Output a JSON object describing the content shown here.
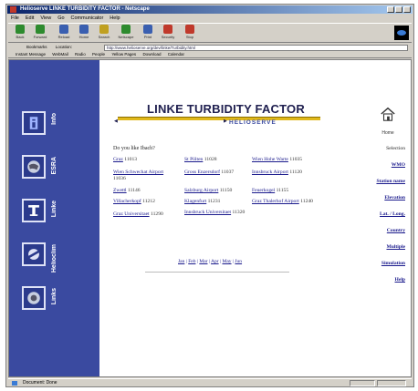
{
  "window": {
    "title": "Helioserve LINKE TURBIDITY FACTOR - Netscape"
  },
  "menu": [
    "File",
    "Edit",
    "View",
    "Go",
    "Communicator",
    "Help"
  ],
  "toolbar": {
    "buttons": [
      {
        "label": "Back",
        "icon": "back-icon",
        "color": "#2e8b2e"
      },
      {
        "label": "Forward",
        "icon": "forward-icon",
        "color": "#2e8b2e"
      },
      {
        "label": "Reload",
        "icon": "reload-icon",
        "color": "#3a5fb0"
      },
      {
        "label": "Home",
        "icon": "home-icon",
        "color": "#3a5fb0"
      },
      {
        "label": "Search",
        "icon": "search-icon",
        "color": "#c0a020"
      },
      {
        "label": "Netscape",
        "icon": "netscape-icon",
        "color": "#2e8b2e"
      },
      {
        "label": "Print",
        "icon": "print-icon",
        "color": "#3a5fb0"
      },
      {
        "label": "Security",
        "icon": "security-icon",
        "color": "#c0392b"
      },
      {
        "label": "Stop",
        "icon": "stop-icon",
        "color": "#c0392b"
      }
    ]
  },
  "address": {
    "bookmarks_label": "Bookmarks",
    "location_label": "Location:",
    "url": "http://www.helioserve.org/dev/linke/Turbidity.html"
  },
  "personal_bar": [
    "Instant Message",
    "WebMail",
    "Radio",
    "People",
    "Yellow Pages",
    "Download",
    "Calendar",
    "Channels"
  ],
  "sidebar": {
    "items": [
      {
        "label": "Info",
        "icon": "info-icon"
      },
      {
        "label": "ESRA",
        "icon": "globe-icon"
      },
      {
        "label": "Linke",
        "icon": "linke-icon"
      },
      {
        "label": "Helioclim",
        "icon": "helioclim-icon"
      },
      {
        "label": "Links",
        "icon": "links-icon"
      }
    ],
    "color": "#3a4aa0"
  },
  "banner": {
    "title": "LINKE TURBIDITY FACTOR",
    "subtitle": "HELIOSERVE"
  },
  "home": {
    "label": "Home"
  },
  "lead": "Do you like Ibach?",
  "stations": [
    {
      "name": "Graz",
      "id": "11013"
    },
    {
      "name": "St Pölten",
      "id": "11028"
    },
    {
      "name": "Wien Hohe Warte",
      "id": "11035"
    },
    {
      "name": "Wien Schwechat Airport",
      "id": "11036"
    },
    {
      "name": "Gross Enzersdorf",
      "id": "11037"
    },
    {
      "name": "Innsbruck Airport",
      "id": "11120"
    },
    {
      "name": "Zwettl",
      "id": "11146"
    },
    {
      "name": "Salzburg Airport",
      "id": "11150"
    },
    {
      "name": "Feuerkogel",
      "id": "11155"
    },
    {
      "name": "Villacherkopf",
      "id": "11212"
    },
    {
      "name": "Klagenfurt",
      "id": "11231"
    },
    {
      "name": "Graz Thalerhof Airport",
      "id": "11240"
    },
    {
      "name": "Graz Universitaet",
      "id": "11290"
    },
    {
      "name": "Innsbruck Universitaet",
      "id": "11320"
    }
  ],
  "months": [
    "Jan",
    "Feb",
    "Mar",
    "Apr",
    "May",
    "Jun",
    "Jul",
    "Aug"
  ],
  "rightnav": {
    "heading": "Selection",
    "links": [
      "WMO",
      "Station name",
      "Elevation",
      "Lat. / Long.",
      "Country",
      "Multiple",
      "Simulation",
      "Help"
    ]
  },
  "status": {
    "text": "Document: Done"
  }
}
